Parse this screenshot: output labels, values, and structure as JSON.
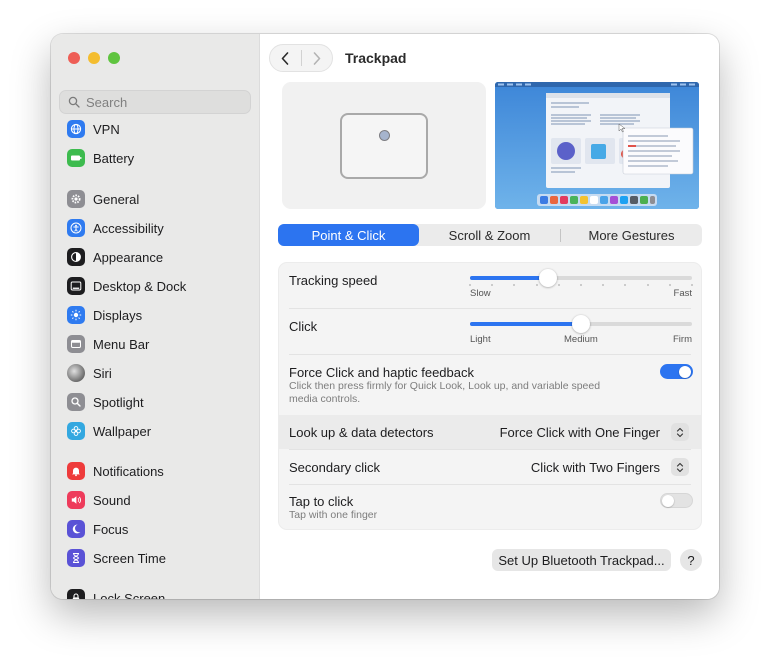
{
  "window": {
    "title": "Trackpad"
  },
  "sidebar": {
    "search_placeholder": "Search",
    "items": [
      {
        "label": "VPN",
        "icon": "globe-icon",
        "color": "#2f7bf0"
      },
      {
        "label": "Battery",
        "icon": "battery-icon",
        "color": "#3dbb4e"
      },
      {
        "label": "General",
        "icon": "gear-icon",
        "color": "#8e8e93"
      },
      {
        "label": "Accessibility",
        "icon": "accessibility-icon",
        "color": "#2f7bf0"
      },
      {
        "label": "Appearance",
        "icon": "appearance-icon",
        "color": "#1d1d1f"
      },
      {
        "label": "Desktop & Dock",
        "icon": "dock-icon",
        "color": "#1d1d1f"
      },
      {
        "label": "Displays",
        "icon": "sun-icon",
        "color": "#2f7bf0"
      },
      {
        "label": "Menu Bar",
        "icon": "menu-bar-icon",
        "color": "#8e8e93"
      },
      {
        "label": "Siri",
        "icon": "siri-icon",
        "color": "#4a4a4a"
      },
      {
        "label": "Spotlight",
        "icon": "magnifier-icon",
        "color": "#8e8e93"
      },
      {
        "label": "Wallpaper",
        "icon": "flower-icon",
        "color": "#33a8e0"
      },
      {
        "label": "Notifications",
        "icon": "bell-icon",
        "color": "#ee3b3b"
      },
      {
        "label": "Sound",
        "icon": "speaker-icon",
        "color": "#ee3b5b"
      },
      {
        "label": "Focus",
        "icon": "moon-icon",
        "color": "#5a52d6"
      },
      {
        "label": "Screen Time",
        "icon": "hourglass-icon",
        "color": "#5a52d6"
      },
      {
        "label": "Lock Screen",
        "icon": "lock-icon",
        "color": "#1d1d1f"
      }
    ]
  },
  "tabs": [
    {
      "label": "Point & Click",
      "active": true
    },
    {
      "label": "Scroll & Zoom",
      "active": false
    },
    {
      "label": "More Gestures",
      "active": false
    }
  ],
  "settings": {
    "tracking_speed": {
      "label": "Tracking speed",
      "min_label": "Slow",
      "max_label": "Fast",
      "value_fraction": 0.35
    },
    "click": {
      "label": "Click",
      "min_label": "Light",
      "mid_label": "Medium",
      "max_label": "Firm",
      "value_fraction": 0.5
    },
    "force_click": {
      "label": "Force Click and haptic feedback",
      "description": "Click then press firmly for Quick Look, Look up, and variable speed media controls.",
      "enabled": true
    },
    "look_up": {
      "label": "Look up & data detectors",
      "value": "Force Click with One Finger"
    },
    "secondary_click": {
      "label": "Secondary click",
      "value": "Click with Two Fingers"
    },
    "tap_to_click": {
      "label": "Tap to click",
      "description": "Tap with one finger",
      "enabled": false
    }
  },
  "buttons": {
    "bluetooth": "Set Up Bluetooth Trackpad...",
    "help": "?"
  },
  "colors": {
    "accent": "#2c74f0",
    "sidebar_bg": "#e9e9e8"
  }
}
